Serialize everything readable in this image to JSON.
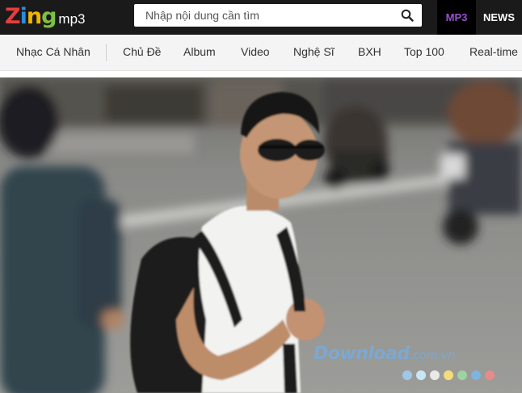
{
  "header": {
    "logo": {
      "brand": "Zing",
      "product": "mp3"
    },
    "search": {
      "placeholder": "Nhập nội dung cần tìm",
      "value": "",
      "icon": "search-icon"
    },
    "nav": [
      {
        "label": "MP3",
        "active": true
      },
      {
        "label": "NEWS",
        "active": false
      }
    ]
  },
  "menu": {
    "items": [
      "Nhạc Cá Nhân",
      "Chủ Đề",
      "Album",
      "Video",
      "Nghệ Sĩ",
      "BXH",
      "Top 100",
      "Real-time"
    ]
  },
  "watermark": {
    "brand": "Download",
    "domain": ".com.vn"
  },
  "colors": {
    "topbar": "#1a1a1a",
    "active_tab": "#9b4fd3",
    "menu_bg": "#f4f4f4",
    "logo_letters": [
      "#e53e3e",
      "#2b8be0",
      "#f2b600",
      "#7cc142"
    ],
    "watermark_dots": [
      "#9fc7e8",
      "#c9e6f5",
      "#e9e9e9",
      "#f3dd7a",
      "#9cd3a0",
      "#7fb3e0",
      "#e88a8a"
    ]
  }
}
